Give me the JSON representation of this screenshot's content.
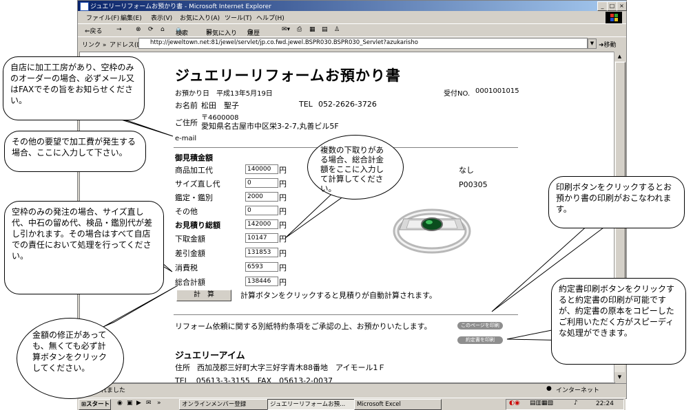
{
  "window": {
    "title": "ジュエリーリフォームお預かり書 - Microsoft Internet Explorer",
    "controls": [
      "_",
      "□",
      "×"
    ]
  },
  "menu": [
    "ファイル(F)",
    "編集(E)",
    "表示(V)",
    "お気に入り(A)",
    "ツール(T)",
    "ヘルプ(H)"
  ],
  "toolbar": {
    "back": "⇐戻る",
    "forward": "→",
    "search": "検索",
    "favorites": "お気に入り",
    "history": "履歴"
  },
  "address": {
    "links": "リンク »",
    "label": "アドレス(D)",
    "url": "http://jeweltown.net:81/jewel/servlet/jp.co.fwd.jewel.BSPR030.BSPR030_Servlet?azukarisho",
    "go": "移動"
  },
  "page": {
    "title": "ジュエリーリフォームお預かり書",
    "date_label": "お預かり日",
    "date": "平成13年5月19日",
    "receipt_label": "受付NO.",
    "receipt_no": "0001001015",
    "name_label": "お名前",
    "name": "松田　聖子",
    "tel_label": "TEL",
    "tel": "052-2626-3726",
    "address_label": "ご住所",
    "postal": "〒4600008",
    "address": "愛知県名古屋市中区栄3-2-7,丸善ビル5F",
    "email_label": "e-mail",
    "estimate_heading": "御見積金額",
    "rows": [
      {
        "label": "商品加工代",
        "value": "140000",
        "unit": "円"
      },
      {
        "label": "サイズ直し代",
        "value": "0",
        "unit": "円"
      },
      {
        "label": "鑑定・鑑別",
        "value": "2000",
        "unit": "円"
      },
      {
        "label": "その他",
        "value": "0",
        "unit": "円"
      },
      {
        "label": "お見積り総額",
        "value": "142000",
        "unit": "円"
      },
      {
        "label": "下取金額",
        "value": "10147",
        "unit": "円"
      },
      {
        "label": "差引金額",
        "value": "131853",
        "unit": "円"
      },
      {
        "label": "消費税",
        "value": "6593",
        "unit": "円"
      },
      {
        "label": "総合計額",
        "value": "138446",
        "unit": "円"
      }
    ],
    "right_value_1": "なし",
    "right_value_2": "P00305",
    "calc_button": "計　算",
    "calc_note": "計算ボタンをクリックすると見積りが自動計算されます。",
    "agreement": "リフォーム依頼に関する別紙特約条項をご承認の上、お預かりいたします。",
    "print_page_button": "このページを印刷",
    "print_contract_button": "約定書を印刷",
    "shop_name": "ジュエリーアイム",
    "shop_address_label": "住所",
    "shop_address": "西加茂郡三好町大字三好字青木88番地　アイモール1Ｆ",
    "shop_tel": "TEL　05613-3-3155　FAX　05613-2-0037"
  },
  "status": {
    "text": "表示されました",
    "zone": "インターネット"
  },
  "taskbar": {
    "start": "スタート",
    "items": [
      "オンラインメンバー登録",
      "ジュエリーリフォームお預...",
      "Microsoft Excel"
    ],
    "time": "22:24"
  },
  "callouts": [
    "自店に加工工房があり、空枠のみのオーダーの場合、必ずメール又はFAXでその旨をお知らせください。",
    "その他の要望で加工費が発生する場合、ここに入力して下さい。",
    "空枠のみの発注の場合、サイズ直し代、中石の留め代、検品・鑑別代が差し引かれます。その場合はすべて自店での責任において処理を行ってください。",
    "金額の修正があっても、無くても必ず計算ボタンをクリックしてください。",
    "複数の下取りがある場合、総合計金額をここに入力して計算してください。",
    "印刷ボタンをクリックするとお預かり書の印刷がおこなわれます。",
    "約定書印刷ボタンをクリックすると約定書の印刷が可能ですが、約定書の原本をコピーしたご利用いただく方がスピーディな処理ができます。"
  ]
}
